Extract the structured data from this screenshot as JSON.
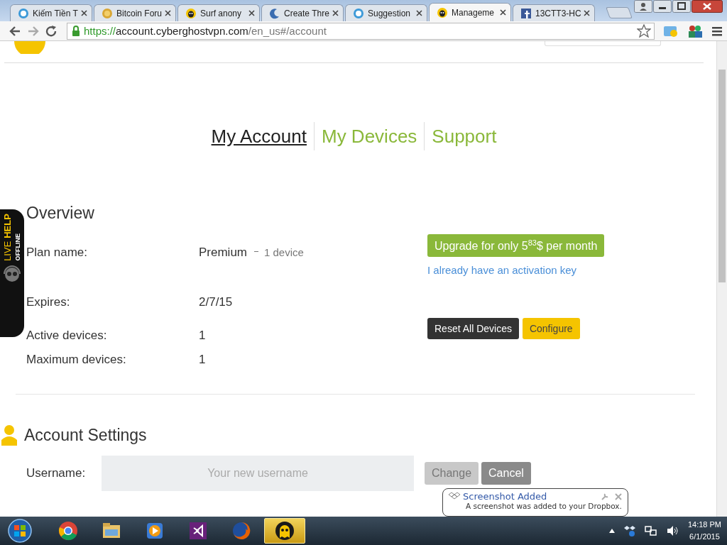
{
  "browser": {
    "tabs": [
      {
        "title": "Kiếm Tiền T",
        "kind": "s",
        "selected": false
      },
      {
        "title": "Bitcoin Foru",
        "kind": "coin",
        "selected": false
      },
      {
        "title": "Surf anony",
        "kind": "ghost",
        "selected": false
      },
      {
        "title": "Create Thre",
        "kind": "moon",
        "selected": false
      },
      {
        "title": "Suggestion",
        "kind": "s",
        "selected": false
      },
      {
        "title": "Manageme",
        "kind": "ghost",
        "selected": true
      },
      {
        "title": "13CTT3-HC",
        "kind": "fb",
        "selected": false
      }
    ],
    "url": {
      "scheme": "https://",
      "host": "account.cyberghostvpn.com",
      "path": "/en_us#/account"
    }
  },
  "nav": [
    {
      "label": "My Account",
      "selected": true
    },
    {
      "label": "My Devices",
      "selected": false
    },
    {
      "label": "Support",
      "selected": false
    }
  ],
  "overview": {
    "title": "Overview",
    "rows": [
      {
        "label": "Plan name:",
        "value": "Premium",
        "note": "1 device",
        "kind": "plan"
      },
      {
        "label": "Expires:",
        "value": "2/7/15",
        "kind": "plain"
      },
      {
        "label": "Active devices:",
        "value": "1",
        "kind": "devices"
      },
      {
        "label": "Maximum devices:",
        "value": "1",
        "kind": "plain"
      }
    ],
    "upgrade_button": "Upgrade for only 5$^{83}$$ per month",
    "activation_link": "I already have an activation key",
    "reset_button": "Reset All Devices",
    "configure_button": "Configure"
  },
  "live_help": {
    "label_light": "LIVE",
    "label_bold": "HELP",
    "status": "OFFLINE"
  },
  "account_settings": {
    "title": "Account Settings",
    "username_label": "Username:",
    "placeholder": "Your new username",
    "change_button": "Change",
    "cancel_button": "Cancel"
  },
  "notification": {
    "title": "Screenshot Added",
    "message": "A screenshot was added to your Dropbox."
  },
  "taskbar": {
    "apps": [
      {
        "kind": "chrome",
        "selected": false
      },
      {
        "kind": "folder",
        "selected": false
      },
      {
        "kind": "media",
        "selected": false
      },
      {
        "kind": "vs",
        "selected": false
      },
      {
        "kind": "firefox",
        "selected": false
      },
      {
        "kind": "ghost",
        "selected": true
      }
    ],
    "time": "14:18 PM",
    "date": "6/1/2015"
  }
}
